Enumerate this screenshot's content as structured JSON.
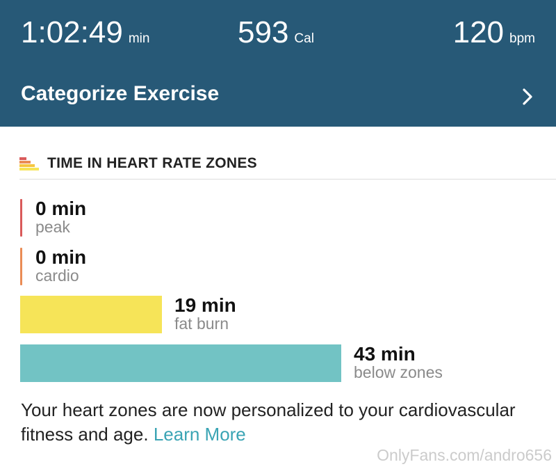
{
  "summary": {
    "duration_value": "1:02:49",
    "duration_unit": "min",
    "calories_value": "593",
    "calories_unit": "Cal",
    "heart_rate_value": "120",
    "heart_rate_unit": "bpm"
  },
  "categorize": {
    "label": "Categorize Exercise",
    "icon": "chevron-right-icon"
  },
  "zones_section": {
    "title": "TIME IN HEART RATE ZONES",
    "icon": "bar-stack-icon",
    "zones": [
      {
        "value": "0 min",
        "label": "peak",
        "minutes": 0,
        "color": "#d95a5a"
      },
      {
        "value": "0 min",
        "label": "cardio",
        "minutes": 0,
        "color": "#ea8c55"
      },
      {
        "value": "19 min",
        "label": "fat burn",
        "minutes": 19,
        "color": "#f6e458"
      },
      {
        "value": "43 min",
        "label": "below zones",
        "minutes": 43,
        "color": "#72c3c4"
      }
    ]
  },
  "footnote": {
    "text": "Your heart zones are now personalized to your cardiovascular fitness and age. ",
    "link": "Learn More"
  },
  "watermark": "OnlyFans.com/andro656",
  "colors": {
    "header_bg": "#275977",
    "link": "#3aa4b4"
  }
}
